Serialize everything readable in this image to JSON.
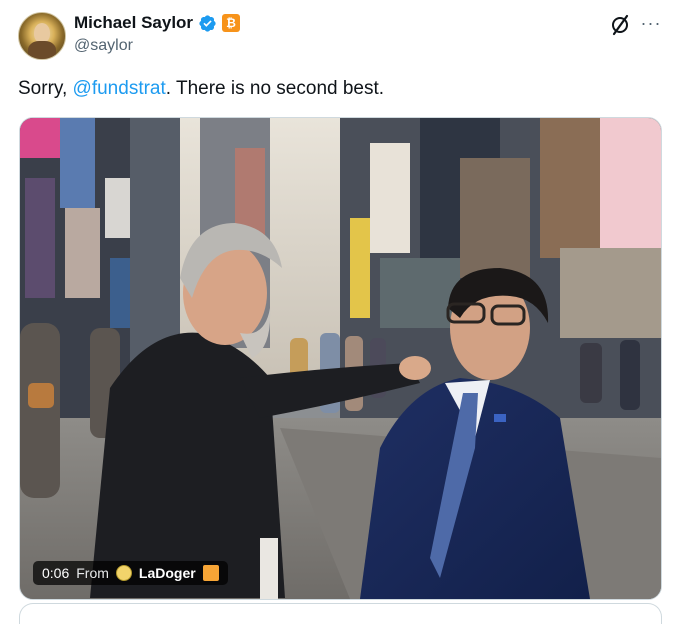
{
  "author": {
    "display_name": "Michael Saylor",
    "handle": "@saylor",
    "avatar_icon": "avatar-portrait",
    "verified_icon": "verified-badge-icon",
    "affiliate_icon": "bitcoin-badge-icon",
    "affiliate_glyph": "₿"
  },
  "header_actions": {
    "grok_icon": "grok-icon",
    "more_icon": "more-options-icon",
    "more_glyph": "···"
  },
  "tweet": {
    "text_before": "Sorry, ",
    "mention": "@fundstrat",
    "text_after": ". There is no second best."
  },
  "video": {
    "timestamp": "0:06",
    "from_label": "From",
    "source_name": "LaDoger"
  },
  "colors": {
    "link": "#1d9bf0",
    "verified": "#1d9bf0",
    "bitcoin": "#f7931a",
    "secondary_text": "#536471"
  }
}
